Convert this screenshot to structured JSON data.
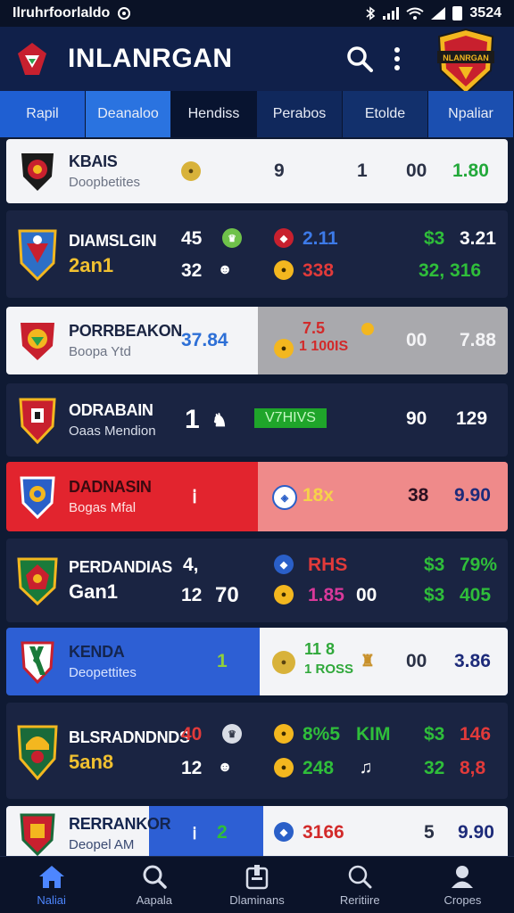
{
  "status": {
    "carrier": "Ilruhrfoorlaldo",
    "time": "3524"
  },
  "app": {
    "title": "INLANRGAN",
    "crest_text": "NLANRGAN"
  },
  "tabs": [
    "Rapil",
    "Deanaloo",
    "Hendiss",
    "Perabos",
    "Etolde",
    "Npaliar"
  ],
  "rows": [
    {
      "name": "KBAIS",
      "sub": "Doopbetites",
      "c1": "9",
      "c2": "1",
      "c3": "00",
      "c4": "1.80"
    },
    {
      "name": "DIAMSLGIN",
      "sub": "2an1",
      "a1": "45",
      "a2": "32",
      "a3": "2.11",
      "a4": "338",
      "a5": "$3",
      "a6": "3.21",
      "a7": "32, 316"
    },
    {
      "name": "PORRBEAKON",
      "sub": "Boopa Ytd",
      "score": "37.84",
      "mid1": "7.5",
      "mid2": "1 100IS",
      "c3": "00",
      "c4": "7.88"
    },
    {
      "name": "ODRABAIN",
      "sub": "Oaas Mendion",
      "score": "1",
      "pill": "V7HIVS",
      "c3": "90",
      "c4": "129"
    },
    {
      "name": "DADNASIN",
      "sub": "Bogas Mfal",
      "val": "18x",
      "c3": "38",
      "c4": "9.90"
    },
    {
      "name": "PERDANDIAS",
      "sub": "Gan1",
      "a1": "4,",
      "a2": "12",
      "a3": "70",
      "b1": "RHS",
      "b2": "1.85",
      "b3": "00",
      "c1": "$3",
      "c2": "79%",
      "c3": "$3",
      "c4": "405"
    },
    {
      "name": "KENDA",
      "sub": "Deopettites",
      "score": "1",
      "val": "11 8",
      "val2": "1 ROSS",
      "c3": "00",
      "c4": "3.86"
    },
    {
      "name": "BLSRADNDNDS",
      "sub": "5an8",
      "a1": "40",
      "a2": "12",
      "b1": "8%5",
      "b2": "KIM",
      "b3": "248",
      "c1": "$3",
      "c2": "146",
      "c3": "32",
      "c4": "8,8"
    },
    {
      "name": "RERRANKOR",
      "sub": "Deopel AM",
      "val": "2",
      "b1": "3166",
      "c3": "5",
      "c4": "9.90"
    }
  ],
  "nav": [
    "Naliai",
    "Aapala",
    "Dlaminans",
    "Reritiire",
    "Cropes"
  ]
}
